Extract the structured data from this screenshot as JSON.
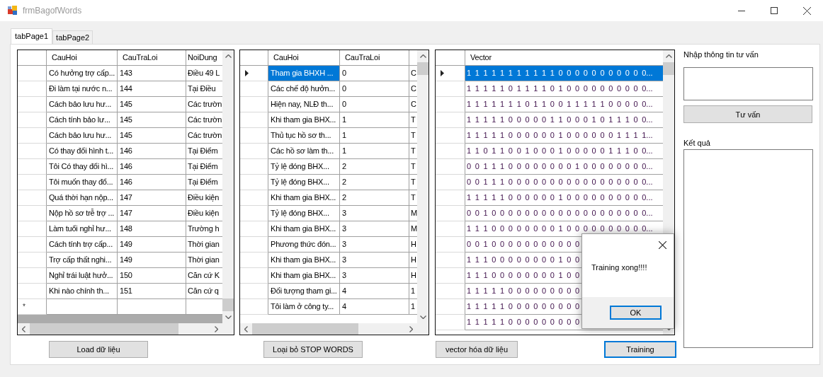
{
  "window": {
    "title": "frmBagofWords"
  },
  "tabs": [
    {
      "label": "tabPage1",
      "selected": true
    },
    {
      "label": "tabPage2",
      "selected": false
    }
  ],
  "grids": [
    {
      "columns": [
        "CauHoi",
        "CauTraLoi",
        "NoiDung"
      ],
      "new_row_marker": "*",
      "rows": [
        {
          "cells": [
            "Có hưởng trợ cấp...",
            "143",
            "Điều 49 L"
          ],
          "selected": false
        },
        {
          "cells": [
            "Đi làm tại nước n...",
            "144",
            "Tại Điều"
          ],
          "selected": false
        },
        {
          "cells": [
            "Cách bảo lưu hư...",
            "145",
            "Các trườn"
          ],
          "selected": false
        },
        {
          "cells": [
            "Cách tính bảo lư...",
            "145",
            "Các trườn"
          ],
          "selected": false
        },
        {
          "cells": [
            "Cách bảo lưu hư...",
            "145",
            "Các trườn"
          ],
          "selected": false
        },
        {
          "cells": [
            "Có thay đổi hình t...",
            "146",
            "Tại Điểm"
          ],
          "selected": false
        },
        {
          "cells": [
            "Tôi Có thay đổi hì...",
            "146",
            "Tại Điểm"
          ],
          "selected": false
        },
        {
          "cells": [
            "Tôi muốn thay đổ...",
            "146",
            "Tại Điểm"
          ],
          "selected": false
        },
        {
          "cells": [
            "Quá thời hạn nộp...",
            "147",
            "Điều kiện"
          ],
          "selected": false
        },
        {
          "cells": [
            "Nộp hồ sơ trễ trợ ...",
            "147",
            "Điều kiện"
          ],
          "selected": false
        },
        {
          "cells": [
            "Làm tuổi nghỉ hư...",
            "148",
            "Trường h"
          ],
          "selected": false
        },
        {
          "cells": [
            "Cách tính trợ cấp...",
            "149",
            "Thời gian"
          ],
          "selected": false
        },
        {
          "cells": [
            "Trợ cấp thất nghi...",
            "149",
            "Thời gian"
          ],
          "selected": false
        },
        {
          "cells": [
            "Nghỉ trái luật hưở...",
            "150",
            "Căn cứ K"
          ],
          "selected": false
        },
        {
          "cells": [
            "Khi nào chính th...",
            "151",
            "Căn cứ q"
          ],
          "selected": false
        }
      ]
    },
    {
      "columns": [
        "CauHoi",
        "CauTraLoi"
      ],
      "rows": [
        {
          "cells": [
            "Tham gia BHXH ...",
            "0",
            "C"
          ],
          "selected": true
        },
        {
          "cells": [
            "Các chế độ hưởn...",
            "0",
            "C"
          ],
          "selected": false
        },
        {
          "cells": [
            "Hiện nay, NLĐ th...",
            "0",
            "C"
          ],
          "selected": false
        },
        {
          "cells": [
            "Khi tham gia BHX...",
            "1",
            "T"
          ],
          "selected": false
        },
        {
          "cells": [
            "Thủ tục hồ sơ th...",
            "1",
            "T"
          ],
          "selected": false
        },
        {
          "cells": [
            "Các hồ sơ làm th...",
            "1",
            "T"
          ],
          "selected": false
        },
        {
          "cells": [
            "Tỷ lệ đóng BHX...",
            "2",
            "T"
          ],
          "selected": false
        },
        {
          "cells": [
            "Tỷ lệ đóng BHX...",
            "2",
            "T"
          ],
          "selected": false
        },
        {
          "cells": [
            "Khi tham gia BHX...",
            "2",
            "T"
          ],
          "selected": false
        },
        {
          "cells": [
            "Tỷ lệ đóng BHX...",
            "3",
            "M"
          ],
          "selected": false
        },
        {
          "cells": [
            "Khi tham gia BHX...",
            "3",
            "M"
          ],
          "selected": false
        },
        {
          "cells": [
            "Phương thức đón...",
            "3",
            "H"
          ],
          "selected": false
        },
        {
          "cells": [
            "Khi tham gia BHX...",
            "3",
            "H"
          ],
          "selected": false
        },
        {
          "cells": [
            "Khi tham gia BHX...",
            "3",
            "H"
          ],
          "selected": false
        },
        {
          "cells": [
            "Đối tượng tham gi...",
            "4",
            "1"
          ],
          "selected": false
        },
        {
          "cells": [
            "Tôi làm ở công ty...",
            "4",
            "1"
          ],
          "selected": false
        }
      ]
    },
    {
      "columns": [
        "Vector"
      ],
      "rows": [
        {
          "cells": [
            "1 1 1 1 1 1 1 1 1 1 1 0 0 0 0 0 0 0 0 0 0 0..."
          ],
          "selected": true
        },
        {
          "cells": [
            "1 1 1 1 1 0 1 1 1 1 0 1 0 0 0 0 0 0 0 0 0 0..."
          ],
          "selected": false
        },
        {
          "cells": [
            "1 1 1 1 1 1 1 0 1 1 0 0 1 1 1 1 1 0 0 0 0 0..."
          ],
          "selected": false
        },
        {
          "cells": [
            "1 1 1 1 1 0 0 0 0 0 1 1 0 0 0 1 0 1 1 1 0 0..."
          ],
          "selected": false
        },
        {
          "cells": [
            "1 1 1 1 1 0 0 0 0 0 0 1 0 0 0 0 0 0 1 1 1 1..."
          ],
          "selected": false
        },
        {
          "cells": [
            "1 1 0 1 1 0 0 1 0 0 0 1 0 0 0 0 0 1 1 1 0 0..."
          ],
          "selected": false
        },
        {
          "cells": [
            "0 0 1 1 1 0 0 0 0 0 0 0 0 1 0 0 0 0 0 0 0 0..."
          ],
          "selected": false
        },
        {
          "cells": [
            "0 0 1 1 1 0 0 0 0 0 0 0 0 0 0 0 0 0 0 0 0 0..."
          ],
          "selected": false
        },
        {
          "cells": [
            "1 1 1 1 1 0 0 0 0 0 0 1 0 0 0 0 0 0 0 0 0 0..."
          ],
          "selected": false
        },
        {
          "cells": [
            "0 0 1 0 0 0 0 0 0 0 0 0 0 0 0 0 0 0 0 0 0 0..."
          ],
          "selected": false
        },
        {
          "cells": [
            "1 1 1 0 0 0 0 0 0 0 0 1 0 0 0 0 0 0 0 0 0 0..."
          ],
          "selected": false
        },
        {
          "cells": [
            "0 0 1 0 0 0 0 0 0 0 0 0 0 0"
          ],
          "selected": false
        },
        {
          "cells": [
            "1 1 1 0 0 0 0 0 0 0 0 1 0 0"
          ],
          "selected": false
        },
        {
          "cells": [
            "1 1 1 0 0 0 0 0 0 0 0 1 0 0"
          ],
          "selected": false
        },
        {
          "cells": [
            "1 1 1 1 1 0 0 0 0 0 0 0 0 0"
          ],
          "selected": false
        },
        {
          "cells": [
            "1 1 1 1 1 0 0 0 0 0 0 0 0 0"
          ],
          "selected": false
        },
        {
          "cells": [
            "1 1 1 1 1 0 0 0 0 0 0 0 0 0"
          ],
          "selected": false
        }
      ]
    }
  ],
  "actions": [
    {
      "label": "Load dữ liệu",
      "focused": false
    },
    {
      "label": "Loại bỏ STOP WORDS",
      "focused": false
    },
    {
      "label": "vector hóa dữ liệu",
      "focused": false
    },
    {
      "label": "Training",
      "focused": true
    }
  ],
  "side_panel": {
    "input_label": "Nhập thông tin tư vấn",
    "button": "Tư vấn",
    "result_label": "Kết quả"
  },
  "dialog": {
    "message": "Training xong!!!!",
    "button": "OK"
  }
}
